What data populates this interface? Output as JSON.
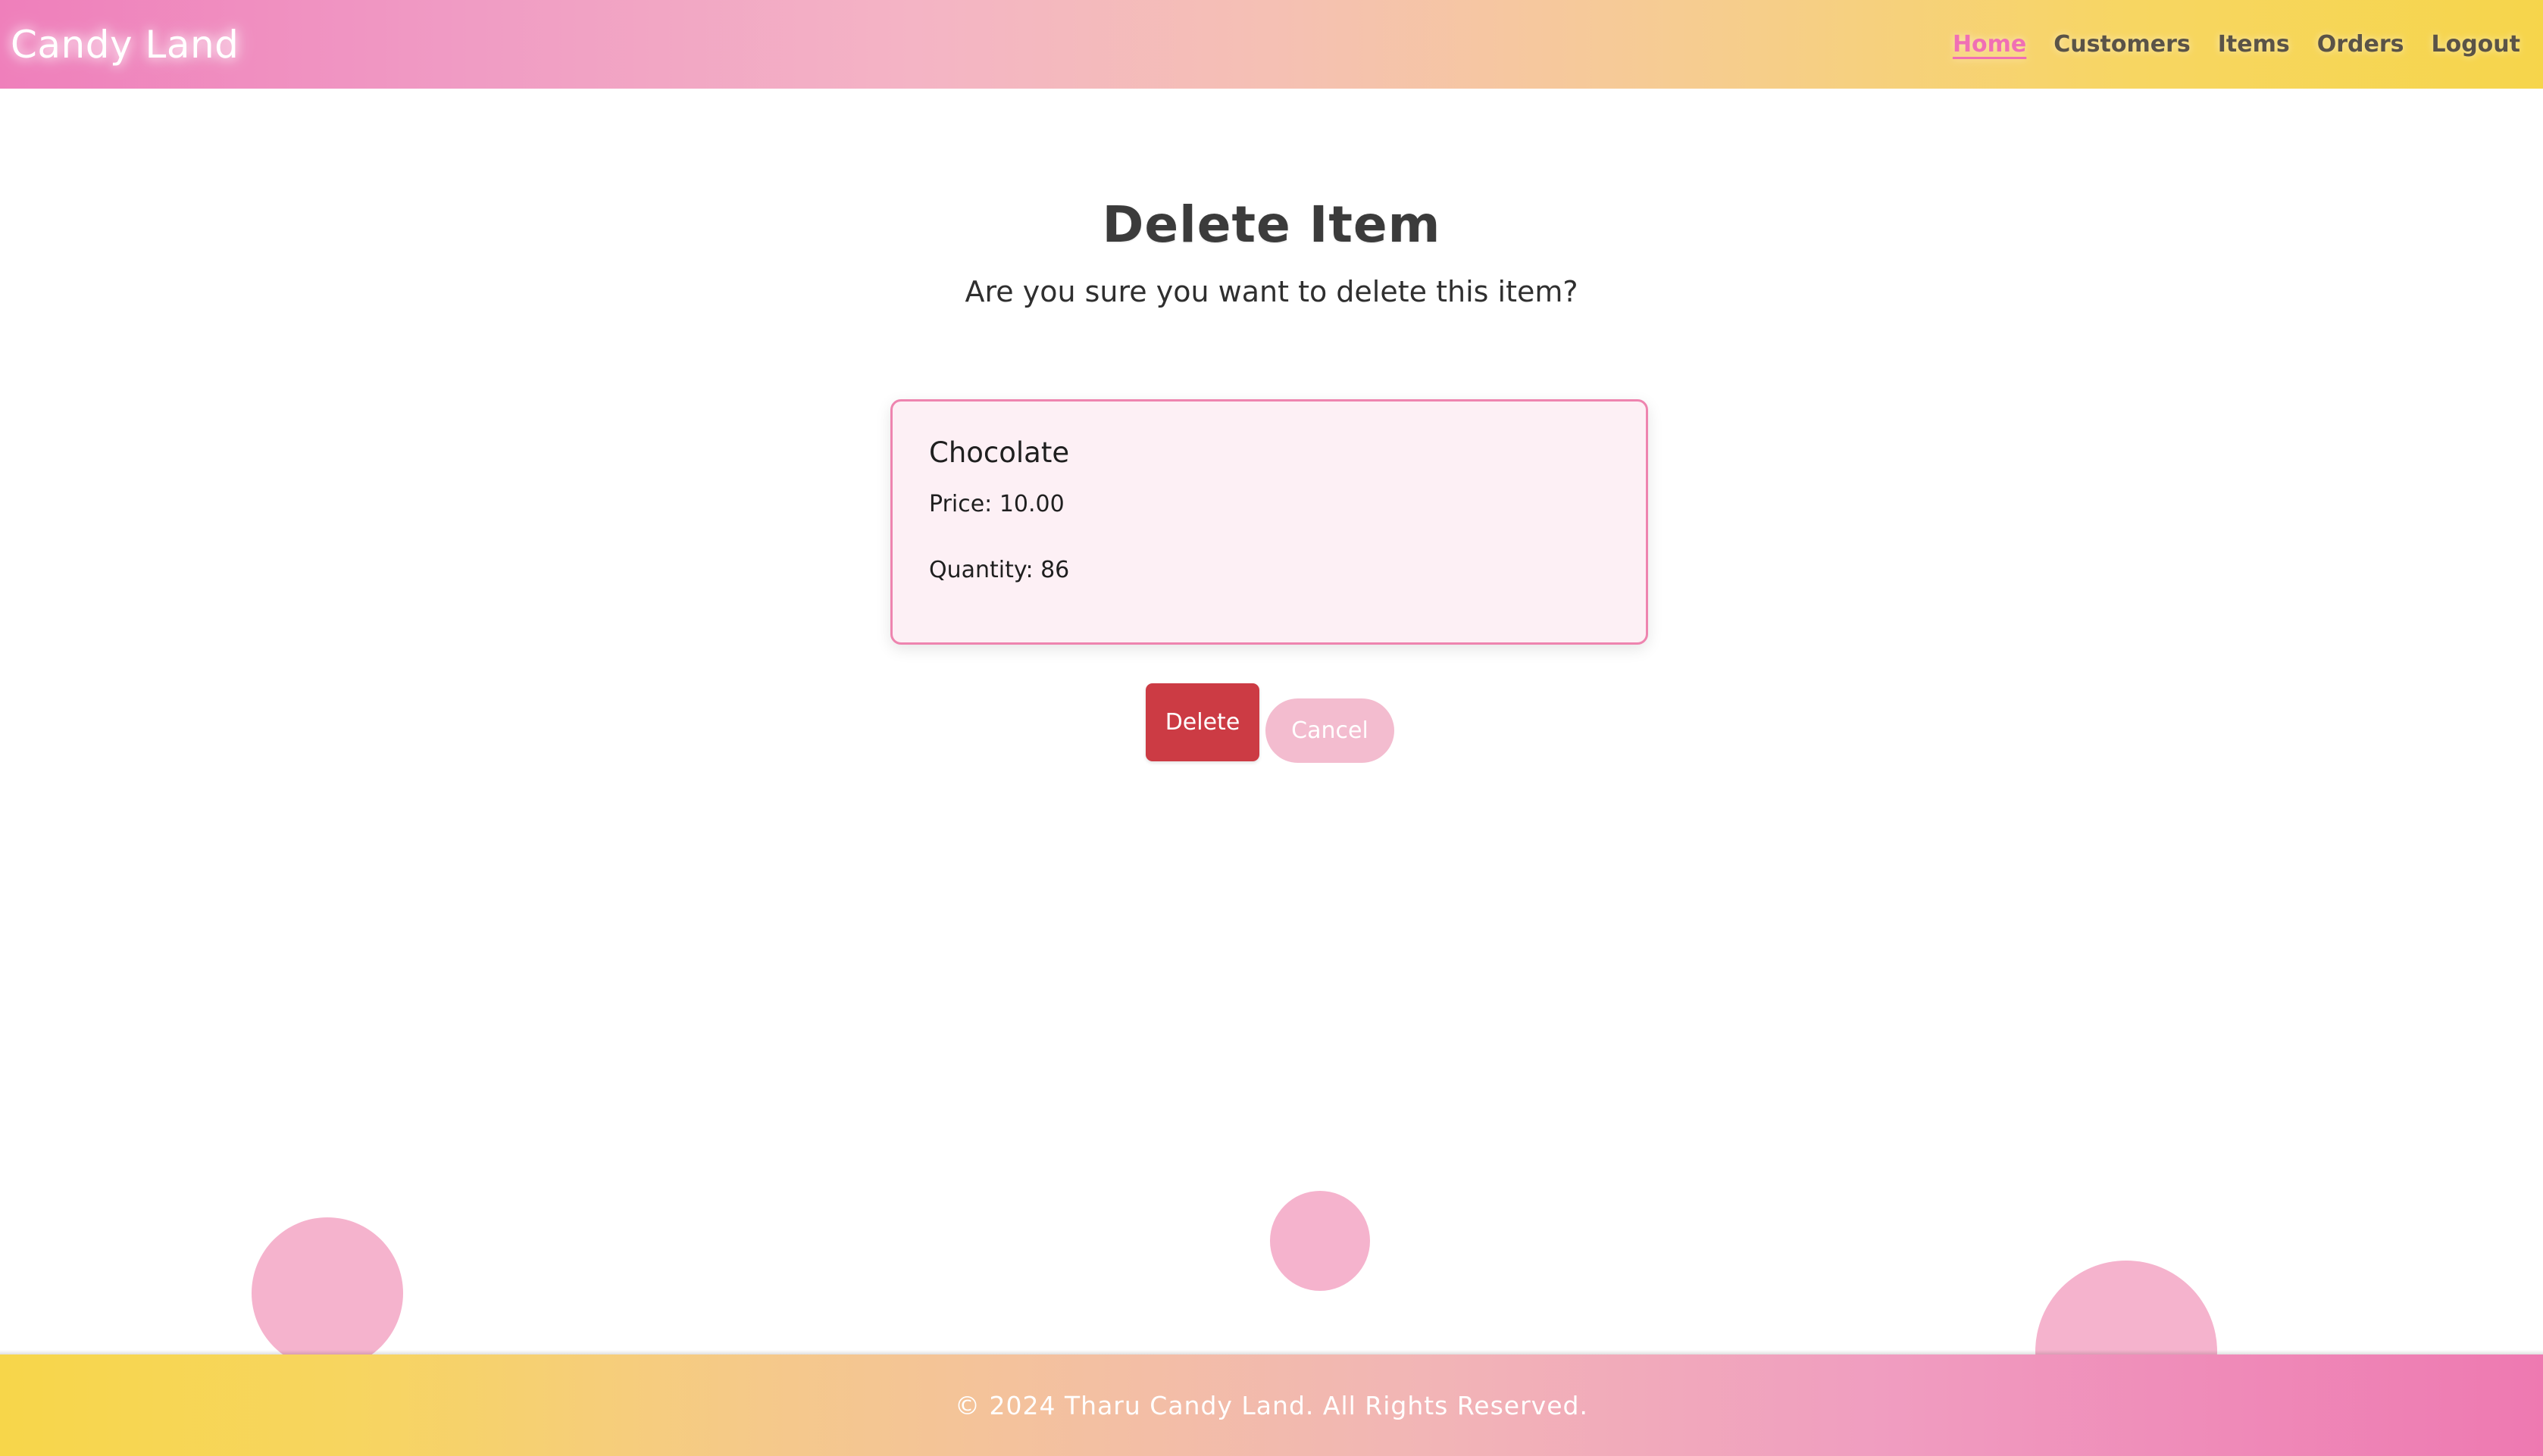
{
  "header": {
    "brand": "Candy Land",
    "nav": [
      {
        "label": "Home",
        "active": true
      },
      {
        "label": "Customers",
        "active": false
      },
      {
        "label": "Items",
        "active": false
      },
      {
        "label": "Orders",
        "active": false
      },
      {
        "label": "Logout",
        "active": false
      }
    ]
  },
  "main": {
    "title": "Delete Item",
    "subtitle": "Are you sure you want to delete this item?",
    "item": {
      "name": "Chocolate",
      "price_line": "Price: 10.00",
      "quantity_line": "Quantity: 86"
    },
    "buttons": {
      "delete": "Delete",
      "cancel": "Cancel"
    }
  },
  "footer": {
    "copyright": "© 2024 Tharu Candy Land. All Rights Reserved."
  },
  "colors": {
    "brand_pink": "#ef7fbb",
    "brand_yellow": "#f6d54b",
    "active_link": "#f06fb4",
    "nav_text": "#5a5347",
    "card_bg": "#fdf0f5",
    "card_border": "#ee84af",
    "delete_btn": "#cc3b44",
    "cancel_btn": "#f3bccf",
    "decor_circle": "#f5b3cd"
  }
}
